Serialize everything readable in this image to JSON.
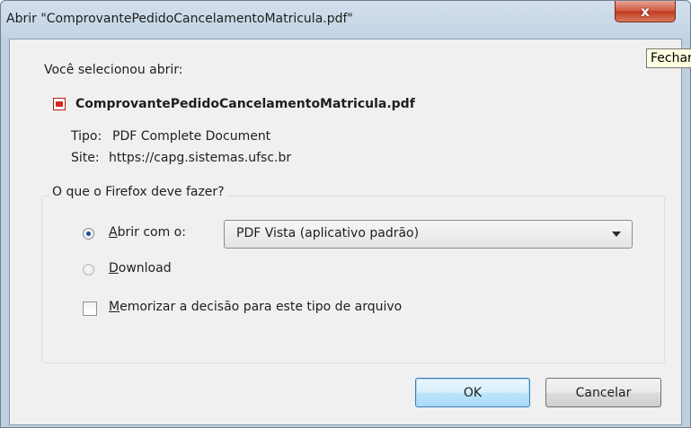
{
  "window": {
    "title": "Abrir \"ComprovantePedidoCancelamentoMatricula.pdf\"",
    "close_glyph": "x",
    "close_tooltip": "Fechar"
  },
  "dialog": {
    "intro": "Você selecionou abrir:",
    "file_name": "ComprovantePedidoCancelamentoMatricula.pdf",
    "file_icon": "pdf-file-icon",
    "type_label": "Tipo:",
    "type_value": "PDF Complete Document",
    "site_label": "Site:",
    "site_value": "https://capg.sistemas.ufsc.br"
  },
  "group": {
    "legend": "O que o Firefox deve fazer?",
    "open_with": {
      "accesskey": "A",
      "label_rest": "brir com o:",
      "selected": true
    },
    "app_select": {
      "selected_value": "PDF Vista (aplicativo padrão)"
    },
    "download": {
      "accesskey": "D",
      "label_rest": "ownload",
      "selected": false
    },
    "remember": {
      "accesskey": "M",
      "label_rest": "emorizar a decisão para este tipo de arquivo",
      "checked": false
    }
  },
  "buttons": {
    "ok": "OK",
    "cancel": "Cancelar"
  }
}
